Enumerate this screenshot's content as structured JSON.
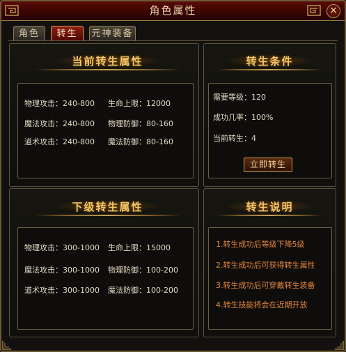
{
  "window": {
    "title": "角色属性",
    "close_label": "×"
  },
  "tabs": [
    {
      "label": "角色"
    },
    {
      "label": "转生"
    },
    {
      "label": "元神装备"
    }
  ],
  "current": {
    "title": "当前转生属性",
    "stats": [
      {
        "label": "物理攻击：240-800"
      },
      {
        "label": "生命上限：12000"
      },
      {
        "label": "魔法攻击：240-800"
      },
      {
        "label": "物理防御：80-160"
      },
      {
        "label": "道术攻击：240-800"
      },
      {
        "label": "魔法防御：80-160"
      }
    ]
  },
  "next": {
    "title": "下级转生属性",
    "stats": [
      {
        "label": "物理攻击：300-1000"
      },
      {
        "label": "生命上限：15000"
      },
      {
        "label": "魔法攻击：300-1000"
      },
      {
        "label": "物理防御：100-200"
      },
      {
        "label": "道术攻击：300-1000"
      },
      {
        "label": "魔法防御：100-200"
      }
    ]
  },
  "conditions": {
    "title": "转生条件",
    "rows": [
      {
        "label": "需要等级：120"
      },
      {
        "label": "成功几率：100%"
      },
      {
        "label": "当前转生：4"
      }
    ],
    "button_label": "立即转生"
  },
  "explain": {
    "title": "转生说明",
    "rules": [
      "1.转生成功后等级下降5级",
      "2.转生成功后可获得转生属性",
      "3.转生成功后可穿戴转生装备",
      "4.转生技能将会在近期开放"
    ]
  },
  "colors": {
    "heading": "#f2c56a",
    "stat_text": "#e2d8c2",
    "rule_text": "#e6863a",
    "active_tab": "#8b1c10"
  }
}
